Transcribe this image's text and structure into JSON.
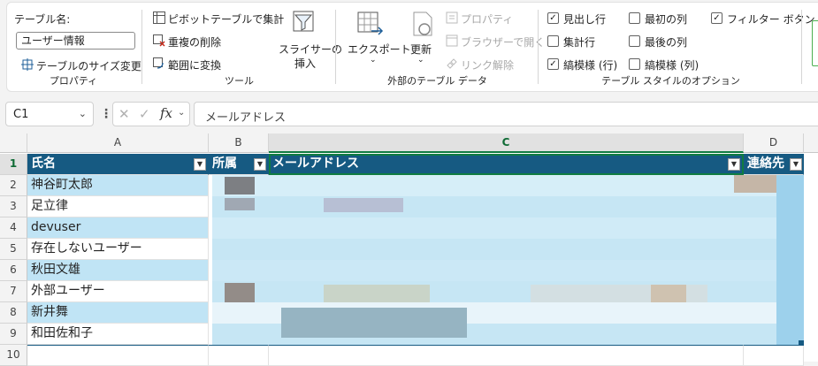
{
  "ribbon": {
    "properties": {
      "table_name_label": "テーブル名:",
      "table_name_value": "ユーザー情報",
      "resize_label": "テーブルのサイズ変更",
      "group_label": "プロパティ"
    },
    "tools": {
      "pivot_label": "ピボットテーブルで集計",
      "remove_dup_label": "重複の削除",
      "convert_label": "範囲に変換",
      "slicer_label_1": "スライサーの",
      "slicer_label_2": "挿入",
      "group_label": "ツール"
    },
    "external": {
      "export_label": "エクスポート",
      "refresh_label": "更新",
      "properties_label": "プロパティ",
      "open_browser_label": "ブラウザーで開く",
      "unlink_label": "リンク解除",
      "group_label": "外部のテーブル データ"
    },
    "style_options": {
      "header_row": {
        "label": "見出し行",
        "checked": true
      },
      "first_col": {
        "label": "最初の列",
        "checked": false
      },
      "filter_btn": {
        "label": "フィルター ボタン",
        "checked": true
      },
      "total_row": {
        "label": "集計行",
        "checked": false
      },
      "last_col": {
        "label": "最後の列",
        "checked": false
      },
      "banded_rows": {
        "label": "縞模様 (行)",
        "checked": true
      },
      "banded_cols": {
        "label": "縞模様 (列)",
        "checked": false
      },
      "group_label": "テーブル スタイルのオプション"
    }
  },
  "formula_bar": {
    "name_box": "C1",
    "formula": "メールアドレス"
  },
  "sheet": {
    "columns": [
      "A",
      "B",
      "C",
      "D"
    ],
    "rows": [
      "1",
      "2",
      "3",
      "4",
      "5",
      "6",
      "7",
      "8",
      "9",
      "10"
    ],
    "headers": {
      "a": "氏名",
      "b": "所属",
      "c": "メールアドレス",
      "d": "連絡先"
    },
    "names": [
      "神谷町太郎",
      "足立律",
      "devuser",
      "存在しないユーザー",
      "秋田文雄",
      "外部ユーザー",
      "新井舞",
      "和田佐和子"
    ]
  },
  "colors": {
    "table_header": "#165a82",
    "band": "#c0e4f5",
    "accent_green": "#107c41"
  }
}
